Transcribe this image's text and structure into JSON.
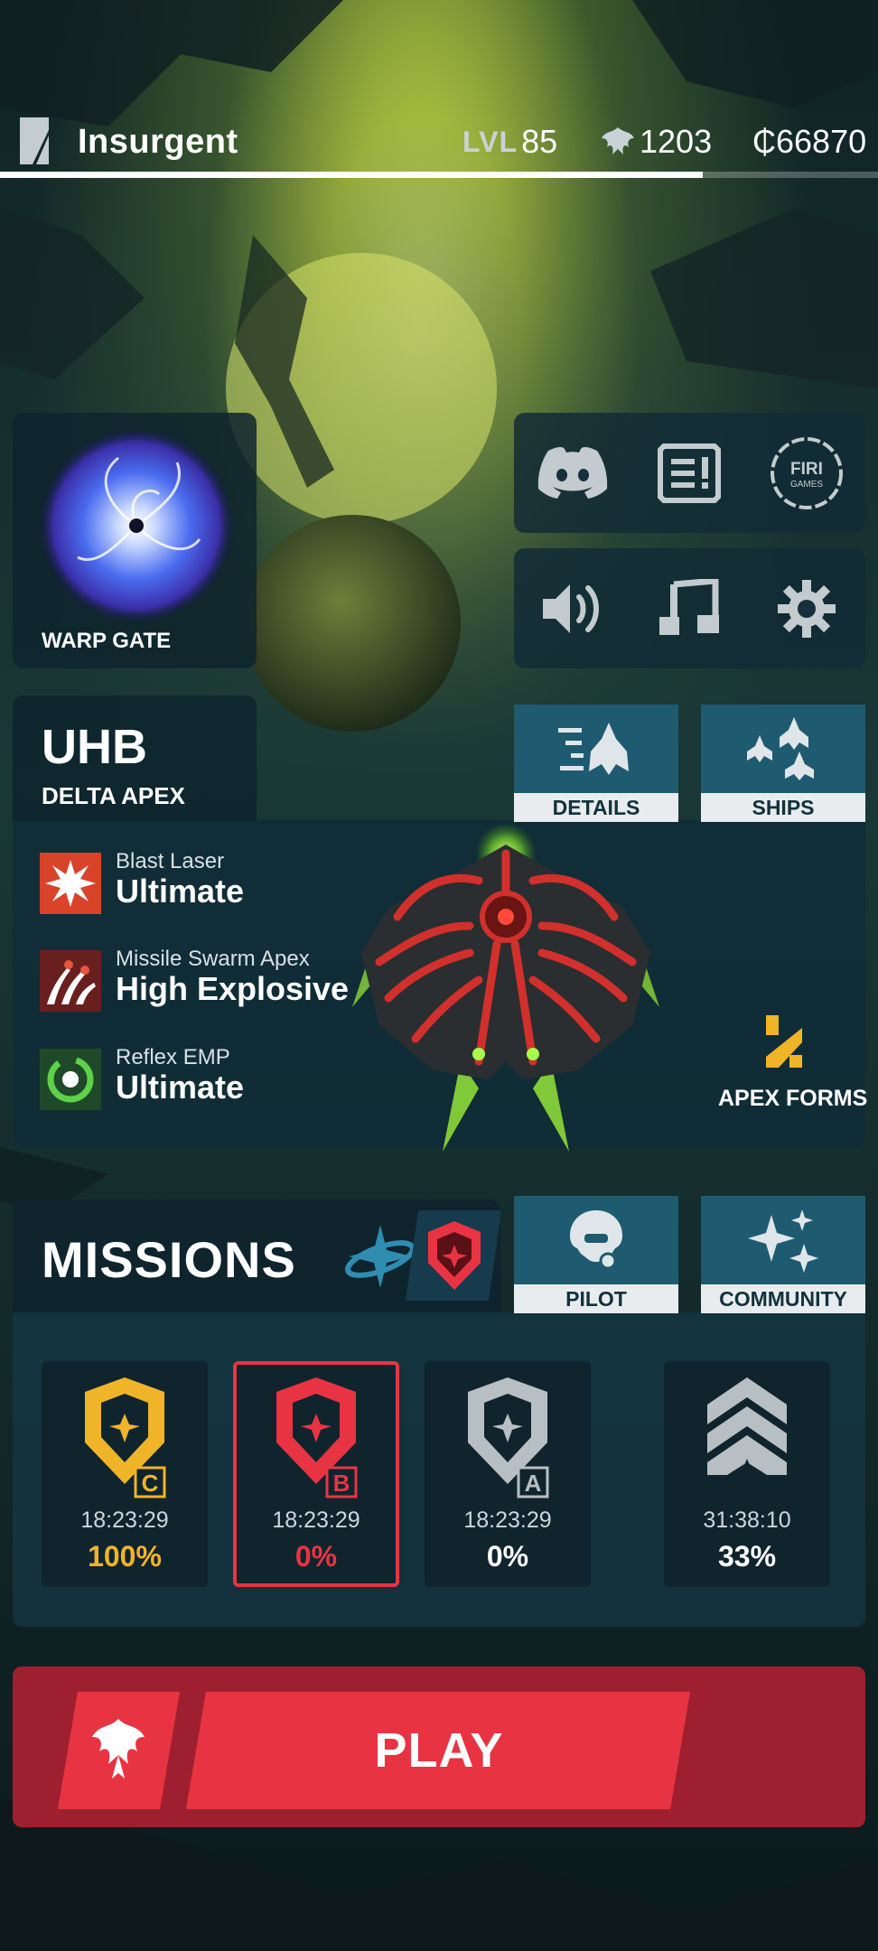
{
  "player": {
    "name": "Insurgent",
    "level_label": "LVL",
    "level": "85",
    "phoenix_currency": "1203",
    "credits": "₵66870",
    "xp_progress": 0.8
  },
  "warp_gate": {
    "label": "WARP GATE"
  },
  "quick_buttons": [
    "discord-icon",
    "news-icon",
    "firi-games-icon",
    "sound-icon",
    "music-icon",
    "settings-icon"
  ],
  "firi_logo": {
    "line1": "FIRI",
    "line2": "GAMES"
  },
  "ship": {
    "name": "UHB",
    "subtitle": "DELTA APEX",
    "details_label": "DETAILS",
    "ships_label": "SHIPS",
    "apex_forms_label": "APEX FORMS",
    "weapons": [
      {
        "name": "Blast Laser",
        "tier": "Ultimate",
        "icon": "blast-laser-icon"
      },
      {
        "name": "Missile Swarm Apex",
        "tier": "High Explosive",
        "icon": "missile-swarm-icon"
      },
      {
        "name": "Reflex EMP",
        "tier": "Ultimate",
        "icon": "reflex-emp-icon"
      }
    ]
  },
  "missions": {
    "title": "MISSIONS",
    "pilot_label": "PILOT",
    "community_label": "COMMUNITY",
    "cards": [
      {
        "grade": "C",
        "time": "18:23:29",
        "percent": "100%",
        "color": "#f0b429"
      },
      {
        "grade": "B",
        "time": "18:23:29",
        "percent": "0%",
        "color": "#e83442"
      },
      {
        "grade": "A",
        "time": "18:23:29",
        "percent": "0%",
        "color": "#b8bfc3"
      },
      {
        "grade": "",
        "time": "31:38:10",
        "percent": "33%",
        "color": "#b8bfc3"
      }
    ]
  },
  "play": {
    "label": "PLAY"
  },
  "colors": {
    "accent_red": "#e83442",
    "gold": "#f0b429",
    "panel_blue": "#1f5b70"
  }
}
